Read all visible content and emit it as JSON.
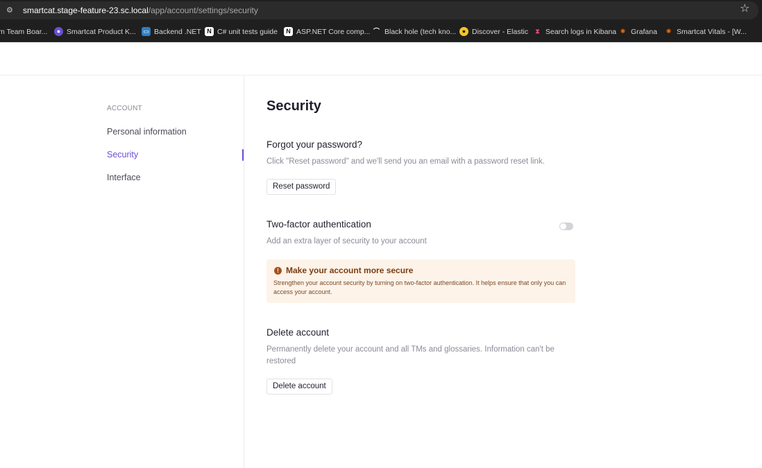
{
  "browser": {
    "url_host": "smartcat.stage-feature-23.sc.local",
    "url_path": "/app/account/settings/security",
    "bookmarks": [
      {
        "label": "m Team Boar...",
        "icon": "board-icon",
        "color": "#ffffff"
      },
      {
        "label": "Smartcat Product K...",
        "icon": "smartcat-icon",
        "color": "#b59cff"
      },
      {
        "label": "Backend .NET",
        "icon": "monitor-icon",
        "color": "#4aa3df"
      },
      {
        "label": "C# unit tests guide",
        "icon": "notion-icon",
        "color": "#ffffff"
      },
      {
        "label": "ASP.NET Core comp...",
        "icon": "notion-icon",
        "color": "#ffffff"
      },
      {
        "label": "Black hole (tech kno...",
        "icon": "arc-icon",
        "color": "#ffffff"
      },
      {
        "label": "Discover - Elastic",
        "icon": "elastic-icon",
        "color": "#f3c623"
      },
      {
        "label": "Search logs in Kibana",
        "icon": "kibana-icon",
        "color": "#e8478b"
      },
      {
        "label": "Grafana",
        "icon": "grafana-icon",
        "color": "#f46800"
      },
      {
        "label": "Smartcat Vitals - [W...",
        "icon": "grafana-icon",
        "color": "#f46800"
      }
    ]
  },
  "sidebar": {
    "heading": "ACCOUNT",
    "items": [
      {
        "label": "Personal information",
        "active": false
      },
      {
        "label": "Security",
        "active": true
      },
      {
        "label": "Interface",
        "active": false
      }
    ]
  },
  "main": {
    "title": "Security",
    "password": {
      "title": "Forgot your password?",
      "description": "Click \"Reset password\" and we'll send you an email with a password reset link.",
      "button": "Reset password"
    },
    "two_factor": {
      "title": "Two-factor authentication",
      "description": "Add an extra layer of security to your account",
      "enabled": false,
      "alert_title": "Make your account more secure",
      "alert_text": "Strengthen your account security by turning on two-factor authentication. It helps ensure that only you can access your account."
    },
    "delete": {
      "title": "Delete account",
      "description": "Permanently delete your account and all TMs and glossaries. Information can't be restored",
      "button": "Delete account"
    }
  },
  "colors": {
    "accent": "#6e4fd6",
    "alert_bg": "#fdf3e9",
    "alert_text": "#7a3e12"
  }
}
